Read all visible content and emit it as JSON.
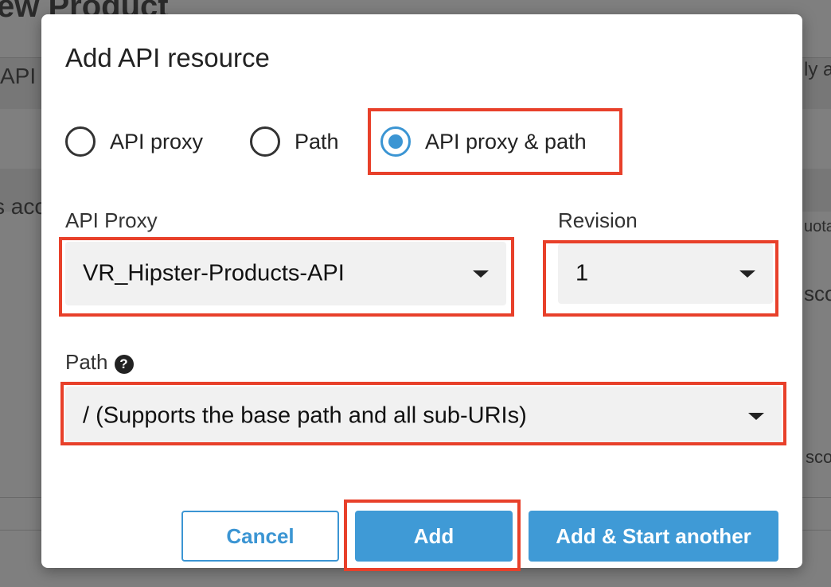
{
  "background": {
    "title_fragment": "ew Product",
    "left_fragments": [
      "API",
      "s acc"
    ],
    "right_fragments": [
      "ly a",
      "uota",
      "sco",
      "sco"
    ]
  },
  "dialog": {
    "title": "Add API resource",
    "radio_options": [
      {
        "label": "API proxy",
        "checked": false
      },
      {
        "label": "Path",
        "checked": false
      },
      {
        "label": "API proxy & path",
        "checked": true
      }
    ],
    "api_proxy": {
      "label": "API Proxy",
      "value": "VR_Hipster-Products-API"
    },
    "revision": {
      "label": "Revision",
      "value": "1"
    },
    "path": {
      "label": "Path",
      "value": "/ (Supports the base path and all sub-URIs)"
    },
    "buttons": {
      "cancel": "Cancel",
      "add": "Add",
      "add_another": "Add & Start another"
    }
  },
  "colors": {
    "accent": "#3f9ad6",
    "highlight": "#e8402a",
    "overlay": "#7f7f7f"
  },
  "icons": {
    "help": "question-circle-icon",
    "select_caret": "caret-down-icon"
  }
}
